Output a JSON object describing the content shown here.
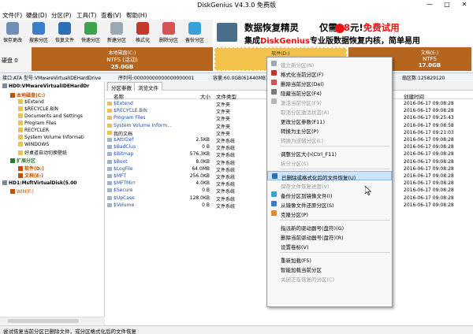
{
  "window": {
    "title": "DiskGenius V4.3.0 免费版",
    "minimize": "—",
    "maximize": "□",
    "close": "✕"
  },
  "menu": [
    "文件(F)",
    "硬盘(D)",
    "分区(P)",
    "工具(T)",
    "查看(V)",
    "帮助(H)"
  ],
  "toolbar": [
    {
      "label": "保存更改",
      "icon": "save-icon",
      "color": "#6b8fb5"
    },
    {
      "label": "搜索分区",
      "icon": "search-partition-icon",
      "color": "#3a7dc9"
    },
    {
      "label": "恢复文件",
      "icon": "recover-file-icon",
      "color": "#2c6fb3"
    },
    {
      "label": "快速分区",
      "icon": "quick-partition-icon",
      "color": "#3fa34d"
    },
    {
      "label": "新建分区",
      "icon": "new-partition-icon",
      "color": "#9aa7b4"
    },
    {
      "label": "格式化",
      "icon": "format-icon",
      "color": "#c0392b"
    },
    {
      "label": "删除分区",
      "icon": "delete-partition-icon",
      "color": "#d35454"
    },
    {
      "label": "备份分区",
      "icon": "backup-partition-icon",
      "color": "#3aa0d8"
    }
  ],
  "ad": {
    "line1_a": "数据恢复精灵",
    "line1_b": "仅需",
    "line1_c": "88",
    "line1_d": "元!",
    "line1_e": "免费试用",
    "line2_a": "集成",
    "line2_b": "DiskGenius",
    "line2_c": "专业版数据恢复内核，简单易用"
  },
  "disk_bar": {
    "label": "硬盘 0",
    "partitions": [
      {
        "name": "本地磁盘(C:)",
        "fs": "NTFS (活动)",
        "size": "25.0GB",
        "color": "#b5651d"
      },
      {
        "name": "软件(D:)",
        "fs": "NTFS",
        "size": "",
        "color": "#f3c24a"
      },
      {
        "name": "文档(E:)",
        "fs": "NTFS",
        "size": "17.0GB",
        "color": "#b5651d"
      }
    ]
  },
  "info_bar": {
    "iface": "接口:ATA",
    "model": "型号:VMwareVirtualIDEHardDrive",
    "serial": "序列号:00000000000000000001",
    "capacity": "容量:60.0GB(61440MB)",
    "sectors": "扇区数:125829120"
  },
  "tree": [
    {
      "label": "HD0:VMwareVirtualIDEHardDr",
      "level": 0,
      "bold": true
    },
    {
      "label": "本地磁盘(C:)",
      "level": 1,
      "bold": true,
      "color": "#c05000"
    },
    {
      "label": "$Extend",
      "level": 2
    },
    {
      "label": "$RECYCLE.BIN",
      "level": 2
    },
    {
      "label": "Documents and Settings",
      "level": 2
    },
    {
      "label": "Program Files",
      "level": 2
    },
    {
      "label": "RECYCLER",
      "level": 2
    },
    {
      "label": "System Volume Informati",
      "level": 2
    },
    {
      "label": "WINDOWS",
      "level": 2
    },
    {
      "label": "好桌道自动切换壁纸",
      "level": 2
    },
    {
      "label": "扩展分区",
      "level": 1,
      "bold": true,
      "color": "#2a7d2a"
    },
    {
      "label": "软件(D:)",
      "level": 2,
      "bold": true,
      "color": "#c05000"
    },
    {
      "label": "文档(E:)",
      "level": 2,
      "bold": true,
      "color": "#c05000"
    },
    {
      "label": "HD1:MsftVirtualDisk(5.00",
      "level": 0,
      "bold": true
    },
    {
      "label": "WIN(F:)",
      "level": 1,
      "color": "#c05000"
    }
  ],
  "tabs": [
    "分区参数",
    "浏览文件"
  ],
  "file_headers": {
    "name": "名称",
    "size": "大小",
    "type": "文件类型",
    "ctime": "创建时间"
  },
  "files": [
    {
      "name": "$Extend",
      "size": "",
      "type": "文件夹",
      "ctime": "2016-06-17 09:08:28"
    },
    {
      "name": "$RECYCLE.BIN",
      "size": "",
      "type": "文件夹",
      "ctime": "2016-06-17 09:08:28"
    },
    {
      "name": "Program Files",
      "size": "",
      "type": "文件夹",
      "ctime": "2016-06-17 09:25:43"
    },
    {
      "name": "System Volume Inform...",
      "size": "",
      "type": "文件夹",
      "ctime": "2016-06-17 09:08:58"
    },
    {
      "name": "我的文档",
      "size": "",
      "type": "文件夹",
      "ctime": "2016-06-17 09:21:03"
    },
    {
      "name": "$AttrDef",
      "size": "2.5KB",
      "type": "文件系统",
      "ctime": "2016-06-17 09:08:28"
    },
    {
      "name": "$BadClus",
      "size": "0 B",
      "type": "文件系统",
      "ctime": "2016-06-17 09:08:28"
    },
    {
      "name": "$Bitmap",
      "size": "576.3KB",
      "type": "文件系统",
      "ctime": "2016-06-17 09:08:28"
    },
    {
      "name": "$Boot",
      "size": "8.0KB",
      "type": "文件系统",
      "ctime": "2016-06-17 09:08:28"
    },
    {
      "name": "$LogFile",
      "size": "64.0MB",
      "type": "文件系统",
      "ctime": "2016-06-17 09:08:28"
    },
    {
      "name": "$MFT",
      "size": "256.0KB",
      "type": "文件系统",
      "ctime": "2016-06-17 09:08:28"
    },
    {
      "name": "$MFTMirr",
      "size": "4.0KB",
      "type": "文件系统",
      "ctime": "2016-06-17 09:08:28"
    },
    {
      "name": "$Secure",
      "size": "0 B",
      "type": "文件系统",
      "ctime": "2016-06-17 09:08:28"
    },
    {
      "name": "$UpCase",
      "size": "128.0KB",
      "type": "文件系统",
      "ctime": "2016-06-17 09:08:28"
    },
    {
      "name": "$Volume",
      "size": "0 B",
      "type": "文件系统",
      "ctime": "2016-06-17 09:08:28"
    }
  ],
  "context_menu": [
    {
      "label": "建立新分区(N)",
      "disabled": true,
      "icon": "new-partition-icon",
      "color": "#9aa7b4"
    },
    {
      "label": "格式化当前分区(F)",
      "icon": "format-icon",
      "color": "#c0392b"
    },
    {
      "label": "删除当前分区(Del)",
      "icon": "delete-icon",
      "color": "#d35454"
    },
    {
      "label": "隐藏当前分区(F4)",
      "icon": "hide-icon",
      "color": "#7a7a7a"
    },
    {
      "label": "激活当前分区(F9)",
      "disabled": true,
      "icon": "activate-icon",
      "color": "#b7b7b7"
    },
    {
      "label": "取消分区激活状态(A)",
      "disabled": true,
      "icon": "",
      "color": ""
    },
    {
      "label": "更改分区参数(F11)",
      "icon": "",
      "color": ""
    },
    {
      "label": "转换为主分区(P)",
      "icon": "",
      "color": ""
    },
    {
      "label": "转换为逻辑分区(L)",
      "disabled": true,
      "icon": "",
      "color": ""
    },
    {
      "sep": true
    },
    {
      "label": "调整分区大小(Ctrl_F11)",
      "icon": "",
      "color": ""
    },
    {
      "label": "拆分分区(S)",
      "disabled": true,
      "icon": "",
      "color": ""
    },
    {
      "sep": true
    },
    {
      "label": "已删除或格式化后的文件恢复(U)",
      "highlight": true,
      "icon": "recover-icon",
      "color": "#2c6fb3"
    },
    {
      "label": "保存文件恢复进度(V)",
      "disabled": true,
      "icon": "",
      "color": ""
    },
    {
      "label": "备份分区到镜像文件(I)",
      "icon": "backup-icon",
      "color": "#3aa0d8"
    },
    {
      "label": "从镜像文件还原分区(S)",
      "icon": "restore-icon",
      "color": "#3a7dc9"
    },
    {
      "label": "克隆分区(P)",
      "icon": "clone-icon",
      "color": "#e08a2c"
    },
    {
      "sep": true
    },
    {
      "label": "指派新的驱动器号(盘符)(G)",
      "icon": "",
      "color": ""
    },
    {
      "label": "删除当前驱动器号(盘符)(R)",
      "icon": "",
      "color": ""
    },
    {
      "label": "设置卷标(V)",
      "icon": "",
      "color": ""
    },
    {
      "sep": true
    },
    {
      "label": "重新加载(F5)",
      "icon": "",
      "color": ""
    },
    {
      "label": "智能加载当前分区",
      "icon": "",
      "color": ""
    },
    {
      "label": "关闭正在恢复的分区(C)",
      "disabled": true,
      "icon": "",
      "color": ""
    }
  ],
  "statusbar": {
    "text": "尝试恢复当前分区已删除文件，或分区格式化后的文件恢复"
  }
}
